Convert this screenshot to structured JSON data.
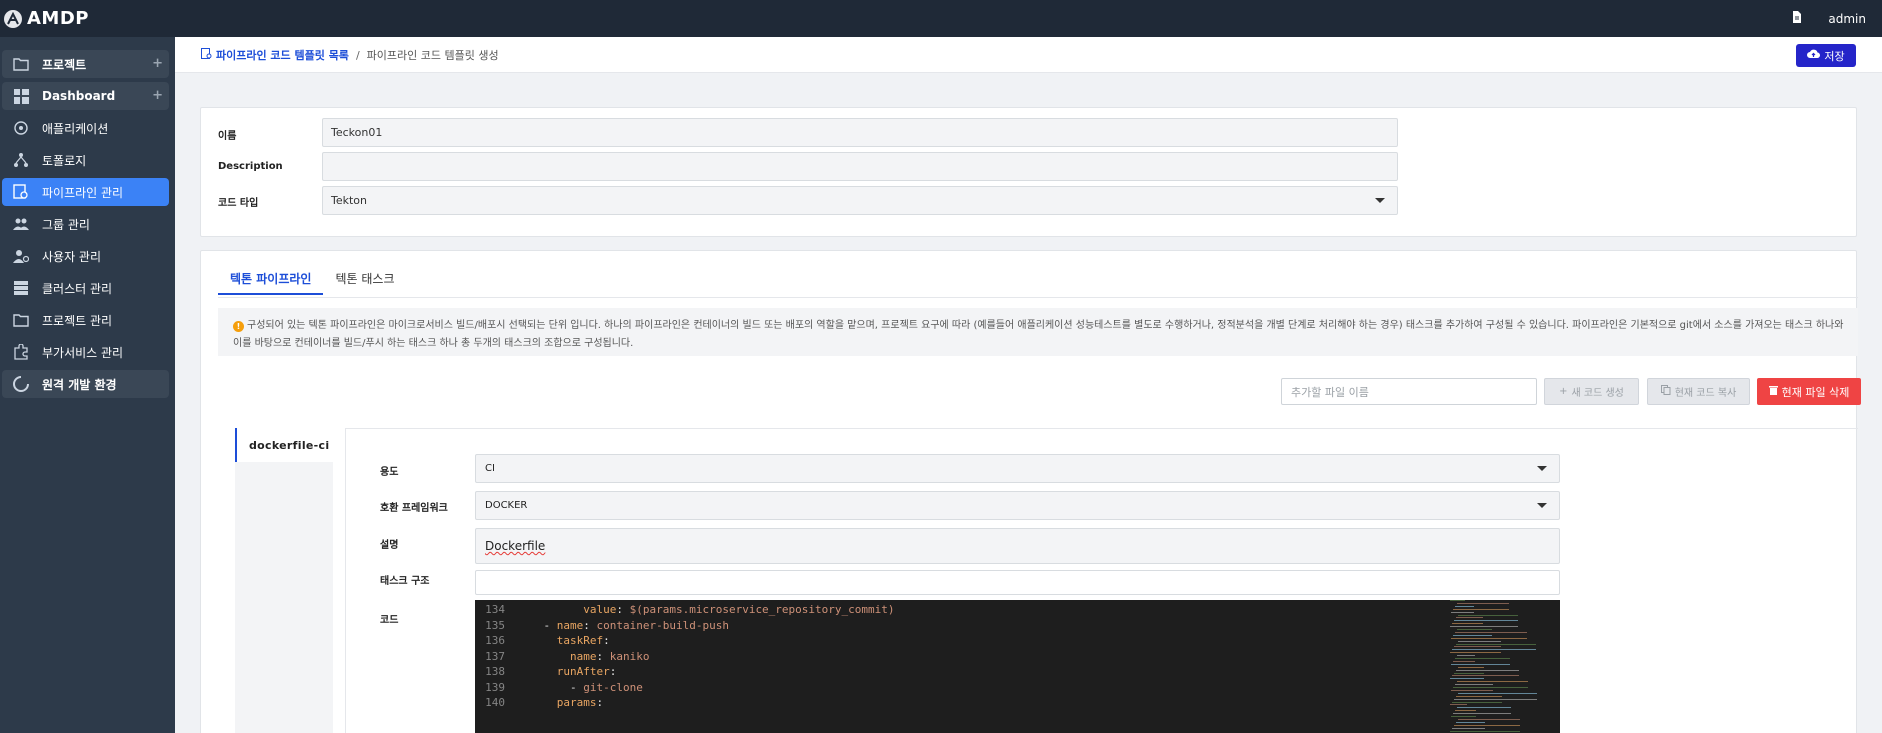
{
  "app": {
    "title": "AMDP",
    "user": "admin",
    "icons": {
      "logo": "amdp-logo-icon",
      "doc": "document-icon"
    }
  },
  "sidebar": {
    "items": [
      {
        "label": "프로젝트",
        "icon": "folder-icon",
        "type": "group",
        "plus": "+"
      },
      {
        "label": "Dashboard",
        "icon": "dashboard-icon",
        "type": "group",
        "plus": "+"
      },
      {
        "label": "애플리케이션",
        "icon": "app-icon",
        "type": "item"
      },
      {
        "label": "토폴로지",
        "icon": "topology-icon",
        "type": "item"
      },
      {
        "label": "파이프라인 관리",
        "icon": "pipeline-icon",
        "type": "active"
      },
      {
        "label": "그룹 관리",
        "icon": "group-icon",
        "type": "item"
      },
      {
        "label": "사용자 관리",
        "icon": "user-gear-icon",
        "type": "item"
      },
      {
        "label": "클러스터 관리",
        "icon": "server-icon",
        "type": "item"
      },
      {
        "label": "프로젝트 관리",
        "icon": "folder-icon",
        "type": "item"
      },
      {
        "label": "부가서비스 관리",
        "icon": "puzzle-icon",
        "type": "item"
      },
      {
        "label": "원격 개발 환경",
        "icon": "loading-icon",
        "type": "group"
      }
    ]
  },
  "header": {
    "breadcrumb_link": "파이프라인 코드 템플릿 목록",
    "breadcrumb_sep": "/",
    "breadcrumb_current": "파이프라인 코드 템플릿 생성",
    "save_label": "저장"
  },
  "form": {
    "name_label": "이름",
    "name_value": "Teckon01",
    "desc_label": "Description",
    "desc_value": "",
    "type_label": "코드 타입",
    "type_value": "Tekton"
  },
  "tabs": [
    {
      "label": "텍톤 파이프라인",
      "active": true
    },
    {
      "label": "텍톤 태스크",
      "active": false
    }
  ],
  "notice": {
    "text": "구성되어 있는 텍톤 파이프라인은 마이크로서비스 빌드/배포시 선택되는 단위 입니다. 하나의 파이프라인은 컨테이너의 빌드 또는 배포의 역할을 맡으며, 프로젝트 요구에 따라 (예를들어 애플리케이션 성능테스트를 별도로 수행하거나, 정적분석을 개별 단계로 처리해야 하는 경우) 태스크를 추가하여 구성될 수 있습니다. 파이프라인은 기본적으로 git에서 소스를 가져오는 태스크 하나와 이를 바탕으로 컨테이너를 빌드/푸시 하는 태스크 하나 총 두개의 태스크의 조합으로 구성됩니다."
  },
  "toolbar": {
    "file_placeholder": "추가할 파일 이름",
    "new_code_label": "새 코드 생성",
    "copy_code_label": "현재 코드 복사",
    "delete_file_label": "현재 파일 삭제"
  },
  "files": [
    {
      "label": "dockerfile-ci",
      "active": true
    }
  ],
  "file_form": {
    "usage_label": "용도",
    "usage_value": "CI",
    "framework_label": "호환 프레임워크",
    "framework_value": "DOCKER",
    "desc_label": "설명",
    "desc_value": "Dockerfile",
    "task_label": "태스크 구조",
    "task_value": "",
    "code_label": "코드"
  },
  "code": {
    "lines": [
      {
        "n": "134",
        "indent": "          ",
        "key": "value",
        "colon": ": ",
        "val": "$(params.microservice_repository_commit)"
      },
      {
        "n": "135",
        "indent": "    - ",
        "key": "name",
        "colon": ": ",
        "val": "container-build-push"
      },
      {
        "n": "136",
        "indent": "      ",
        "key": "taskRef",
        "colon": ":",
        "val": ""
      },
      {
        "n": "137",
        "indent": "        ",
        "key": "name",
        "colon": ": ",
        "val": "kaniko"
      },
      {
        "n": "138",
        "indent": "      ",
        "key": "runAfter",
        "colon": ":",
        "val": ""
      },
      {
        "n": "139",
        "indent": "        - ",
        "key": "",
        "colon": "",
        "val": "git-clone"
      },
      {
        "n": "140",
        "indent": "      ",
        "key": "params",
        "colon": ":",
        "val": ""
      }
    ]
  }
}
